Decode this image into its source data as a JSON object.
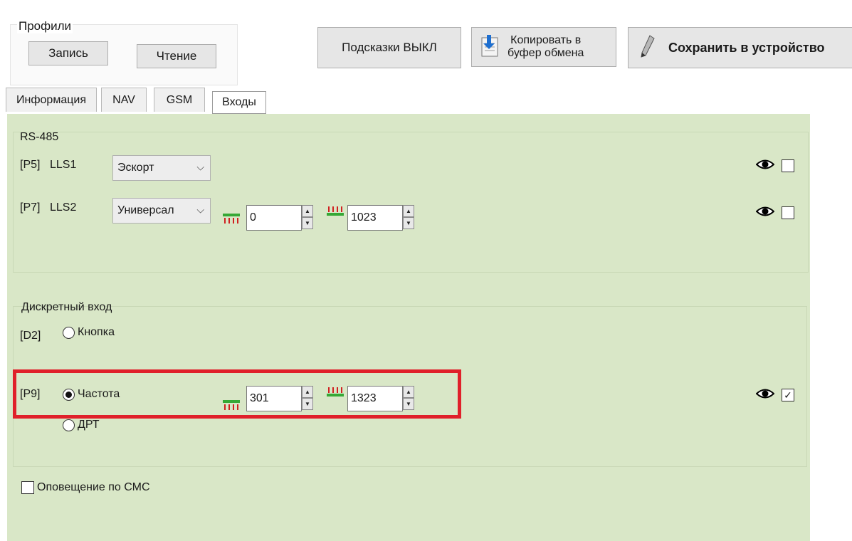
{
  "profiles": {
    "title": "Профили",
    "write_label": "Запись",
    "read_label": "Чтение"
  },
  "toolbar": {
    "hints_label": "Подсказки ВЫКЛ",
    "copy_line1": "Копировать в",
    "copy_line2": "буфер обмена",
    "save_label": "Сохранить в устройство"
  },
  "tabs": [
    {
      "label": "Информация"
    },
    {
      "label": "NAV"
    },
    {
      "label": "GSM"
    },
    {
      "label": "Входы"
    }
  ],
  "rs485": {
    "title": "RS-485",
    "lls1": {
      "port": "[P5]",
      "name": "LLS1",
      "type": "Эскорт",
      "visible_checked": false
    },
    "lls2": {
      "port": "[P7]",
      "name": "LLS2",
      "type": "Универсал",
      "min": "0",
      "max": "1023",
      "visible_checked": false
    }
  },
  "discrete": {
    "title": "Дискретный вход",
    "d2": {
      "port": "[D2]",
      "option": "Кнопка"
    },
    "p9": {
      "port": "[P9]",
      "option_freq": "Частота",
      "option_drt": "ДРТ",
      "min": "301",
      "max": "1323",
      "visible_checked": true
    }
  },
  "sms": {
    "label": "Оповещение по СМС",
    "checked": false
  }
}
